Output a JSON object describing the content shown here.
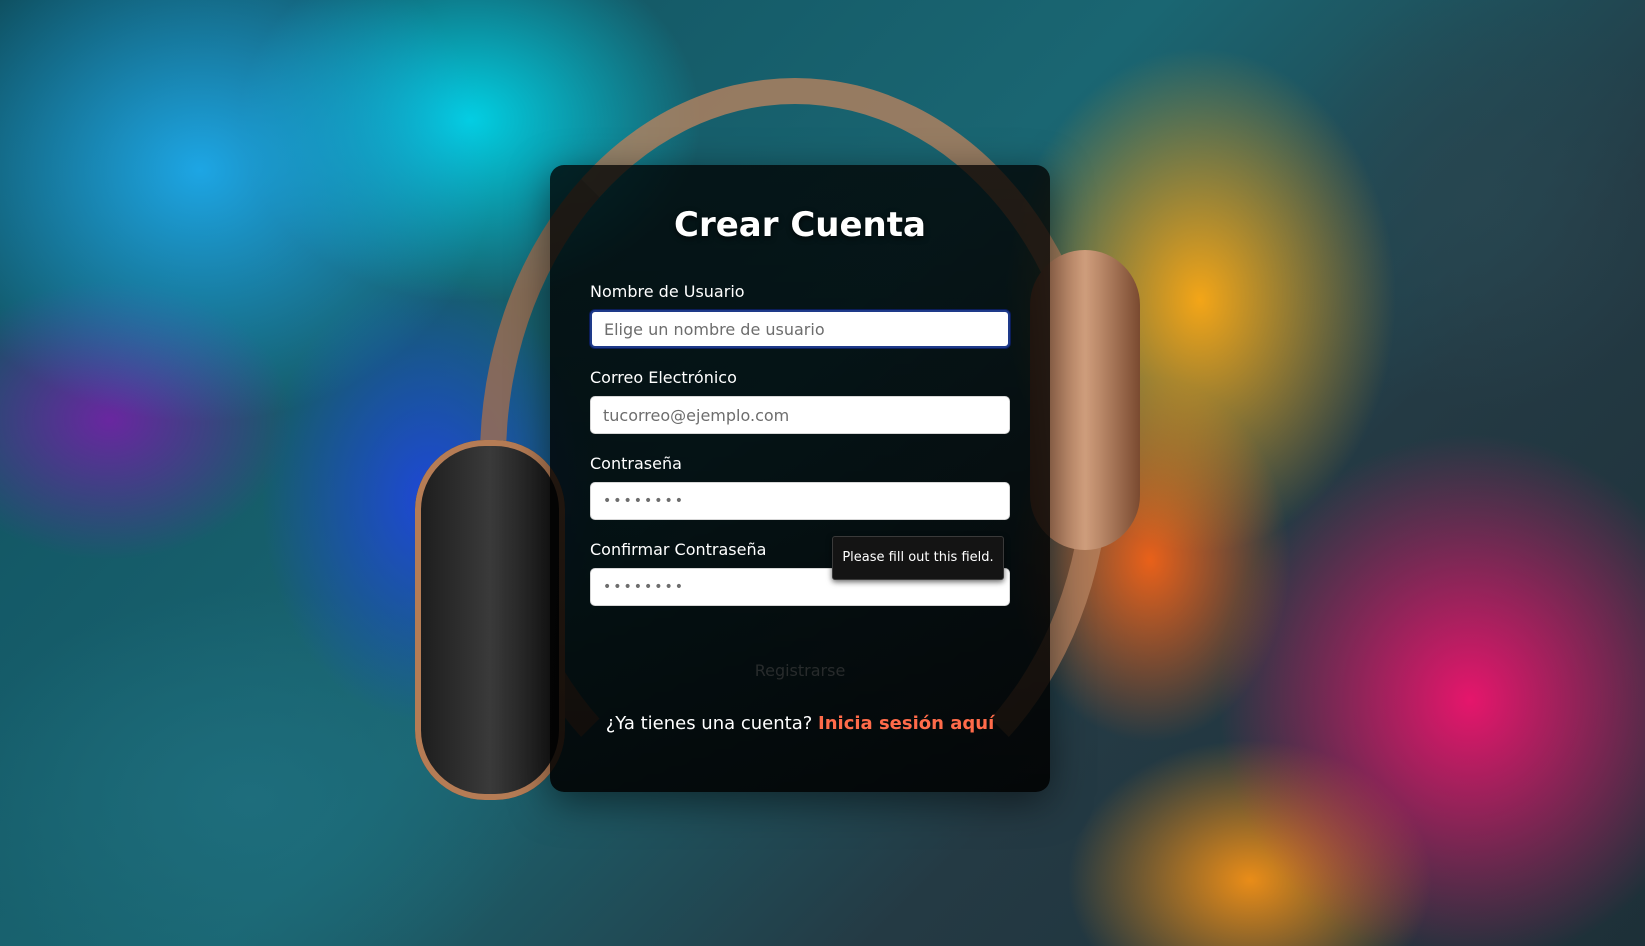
{
  "register": {
    "title": "Crear Cuenta",
    "username": {
      "label": "Nombre de Usuario",
      "placeholder": "Elige un nombre de usuario",
      "value": ""
    },
    "email": {
      "label": "Correo Electrónico",
      "placeholder": "tucorreo@ejemplo.com",
      "value": ""
    },
    "password": {
      "label": "Contraseña",
      "placeholder": "••••••••",
      "value": ""
    },
    "confirm_password": {
      "label": "Confirmar Contraseña",
      "placeholder": "••••••••",
      "value": ""
    },
    "submit_label": "Registrarse",
    "login_prompt": "¿Ya tienes una cuenta?",
    "login_link": "Inicia sesión aquí"
  },
  "validation_tooltip": "Please fill out this field.",
  "colors": {
    "accent_link": "#ff6b4a",
    "focus_border": "#1e3a8a",
    "card_background": "#000000"
  },
  "icons": []
}
